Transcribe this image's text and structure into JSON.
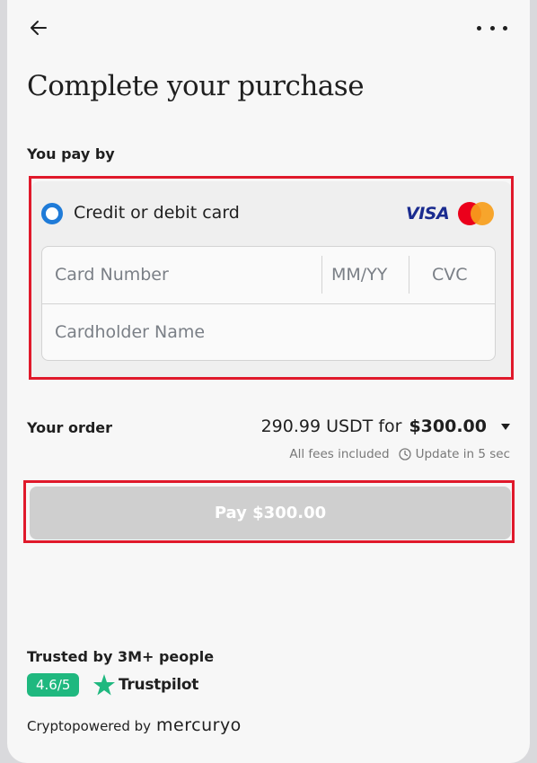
{
  "header": {
    "title": "Complete your purchase"
  },
  "payment": {
    "section_label": "You pay by",
    "method_label": "Credit or debit card",
    "visa_label": "VISA",
    "card_number_placeholder": "Card Number",
    "expiry_placeholder": "MM/YY",
    "cvc_placeholder": "CVC",
    "cardholder_placeholder": "Cardholder Name",
    "accent_color": "#1f7bd8"
  },
  "order": {
    "label": "Your order",
    "amount_text": "290.99 USDT for",
    "price": "$300.00",
    "fees_note": "All fees included",
    "update_note": "Update in 5 sec"
  },
  "pay_button": {
    "label": "Pay $300.00"
  },
  "trust": {
    "label": "Trusted by 3M+ people",
    "rating": "4.6/5",
    "provider": "Trustpilot",
    "badge_color": "#1fb87f"
  },
  "footer": {
    "powered_prefix": "Cryptopowered by",
    "brand": "mercuryo"
  },
  "icons": [
    "back-arrow-icon",
    "more-icon",
    "radio-selected-icon",
    "mastercard-icon",
    "chevron-down-icon",
    "clock-icon",
    "trustpilot-star-icon"
  ]
}
